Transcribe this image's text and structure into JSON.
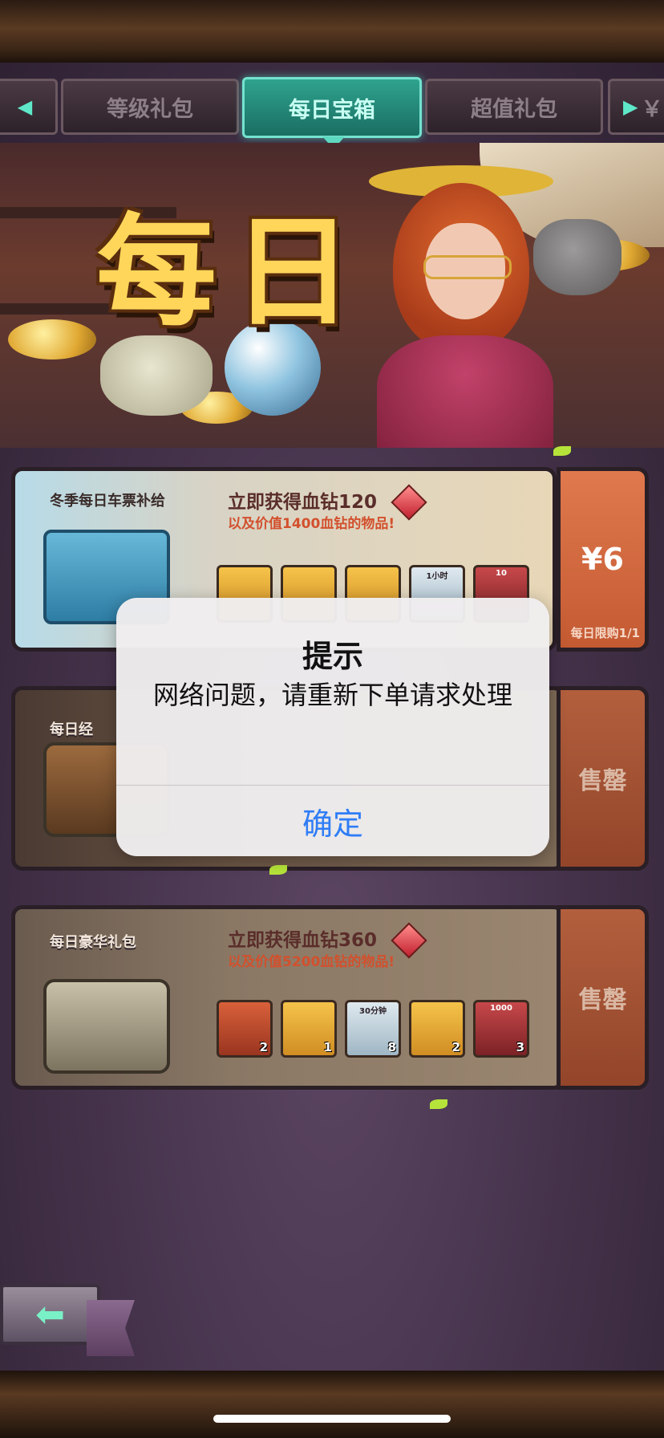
{
  "tabs": {
    "left_partial": "",
    "items": [
      {
        "label": "等级礼包",
        "active": false
      },
      {
        "label": "每日宝箱",
        "active": true
      },
      {
        "label": "超值礼包",
        "active": false
      }
    ],
    "right_partial": "￥"
  },
  "banner": {
    "title_chars": [
      "每",
      "日"
    ]
  },
  "packs": [
    {
      "name": "冬季每日车票补给",
      "offer_main": "立即获得血钻120",
      "offer_sub": "以及价值1400血钻的物品!",
      "price": "¥6",
      "limit": "每日限购1/1",
      "items": [
        {
          "icon": "fish-icon",
          "tag": "",
          "count": ""
        },
        {
          "icon": "cake-icon",
          "tag": "",
          "count": ""
        },
        {
          "icon": "scroll-icon",
          "tag": "",
          "count": ""
        },
        {
          "icon": "coin-icon",
          "tag": "1小时",
          "count": ""
        },
        {
          "icon": "gear-icon",
          "tag": "10",
          "count": ""
        }
      ]
    },
    {
      "name": "每日经",
      "offer_main": "",
      "offer_sub": "",
      "price": "售罄",
      "limit": "",
      "items": []
    },
    {
      "name": "每日豪华礼包",
      "offer_main": "立即获得血钻360",
      "offer_sub": "以及价值5200血钻的物品!",
      "price": "售罄",
      "limit": "",
      "items": [
        {
          "icon": "basket-icon",
          "tag": "",
          "count": "2"
        },
        {
          "icon": "cake-icon",
          "tag": "",
          "count": "1"
        },
        {
          "icon": "clock-icon",
          "tag": "30分钟",
          "count": "8"
        },
        {
          "icon": "ticket-icon",
          "tag": "",
          "count": "2"
        },
        {
          "icon": "coin-icon",
          "tag": "1000",
          "count": "3"
        }
      ]
    }
  ],
  "alert": {
    "title": "提示",
    "message": "网络问题，请重新下单请求处理",
    "confirm": "确定"
  },
  "colors": {
    "accent_tab": "#2fa38e",
    "price_active": "#e0794e",
    "alert_button": "#2f7df6"
  }
}
